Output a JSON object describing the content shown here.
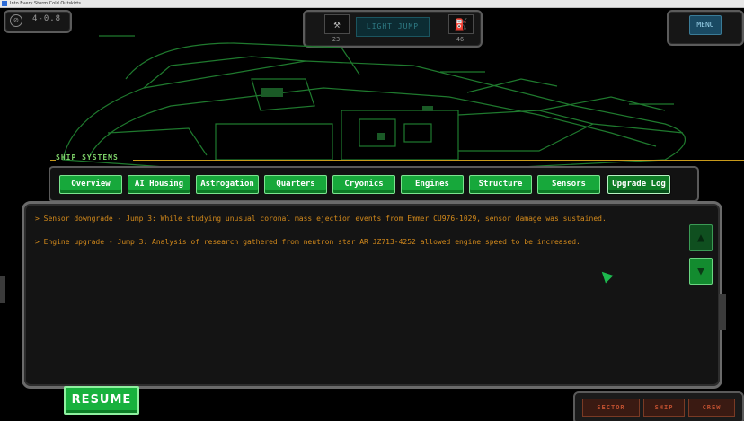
{
  "window": {
    "title": "Into Every Storm Cold Outskirts"
  },
  "hud": {
    "version": "4-0.8",
    "light_jump_label": "LIGHT JUMP",
    "fuel_left_value": "23",
    "fuel_right_value": "46",
    "menu_label": "MENU"
  },
  "ship_systems": {
    "label": "SHIP SYSTEMS",
    "tabs": [
      {
        "label": "Overview"
      },
      {
        "label": "AI Housing"
      },
      {
        "label": "Astrogation"
      },
      {
        "label": "Quarters"
      },
      {
        "label": "Cryonics"
      },
      {
        "label": "Engines"
      },
      {
        "label": "Structure"
      },
      {
        "label": "Sensors"
      },
      {
        "label": "Upgrade Log"
      }
    ],
    "selected_tab": "Upgrade Log"
  },
  "log": {
    "entries": [
      {
        "text": "> Sensor downgrade - Jump 3: While studying unusual coronal mass ejection events from Emmer CU976-1029, sensor damage was sustained."
      },
      {
        "text": "> Engine upgrade - Jump 3: Analysis of research gathered from neutron star AR JZ713-4252 allowed engine speed to be increased."
      }
    ],
    "scroll_up_label": "▲",
    "scroll_down_label": "▼"
  },
  "buttons": {
    "resume_label": "RESUME",
    "sector_label": "SECTOR",
    "ship_label": "SHIP",
    "crew_label": "CREW"
  },
  "colors": {
    "accent_green": "#18b13e",
    "log_text": "#d48a1b",
    "ship_outline": "#1f7a2e",
    "frame_gold": "#c89a1b"
  }
}
